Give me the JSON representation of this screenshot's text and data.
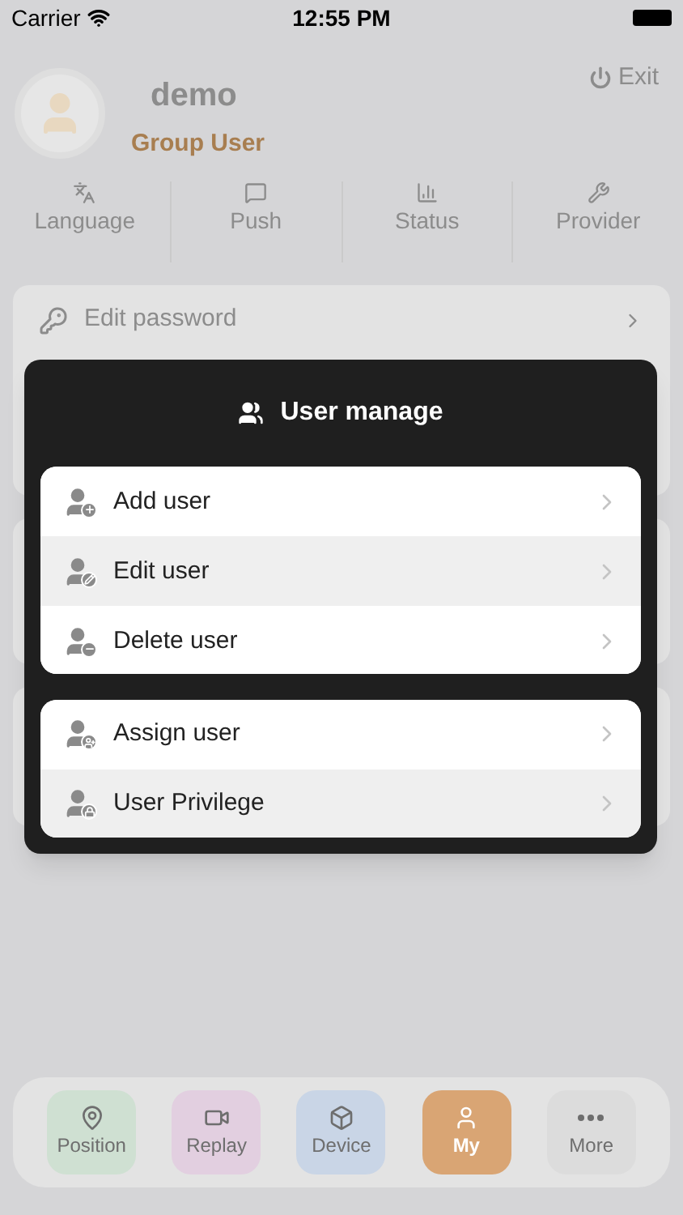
{
  "status_bar": {
    "carrier": "Carrier",
    "time": "12:55 PM"
  },
  "profile": {
    "name": "demo",
    "role": "Group User",
    "exit": "Exit"
  },
  "shortcuts": [
    {
      "kind": "language",
      "label": "Language"
    },
    {
      "kind": "push",
      "label": "Push"
    },
    {
      "kind": "status",
      "label": "Status"
    },
    {
      "kind": "provider",
      "label": "Provider"
    }
  ],
  "settings": [
    {
      "kind": "key",
      "label": "Edit password"
    }
  ],
  "dialog": {
    "title": "User manage",
    "groups": [
      [
        {
          "kind": "add",
          "label": "Add user"
        },
        {
          "kind": "edit",
          "label": "Edit user"
        },
        {
          "kind": "delete",
          "label": "Delete user"
        }
      ],
      [
        {
          "kind": "assign",
          "label": "Assign user"
        },
        {
          "kind": "lock",
          "label": "User Privilege"
        }
      ]
    ]
  },
  "tab_bar": [
    {
      "kind": "pin",
      "label": "Position",
      "color": "#cfe0d2",
      "selected": false
    },
    {
      "kind": "video",
      "label": "Replay",
      "color": "#e2cfe0",
      "selected": false
    },
    {
      "kind": "cube",
      "label": "Device",
      "color": "#c9d5e6",
      "selected": false
    },
    {
      "kind": "person",
      "label": "My",
      "color": "#d9a574",
      "selected": true
    },
    {
      "kind": "dots",
      "label": "More",
      "color": "#dcdcdc",
      "selected": false
    }
  ]
}
